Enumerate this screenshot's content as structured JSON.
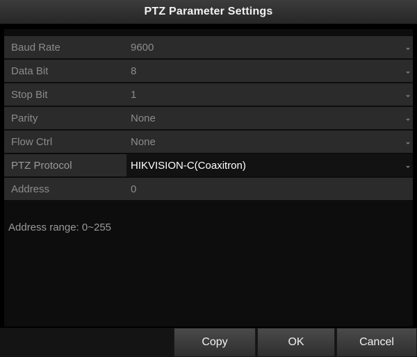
{
  "dialog": {
    "title": "PTZ Parameter Settings"
  },
  "fields": [
    {
      "label": "Baud Rate",
      "value": "9600",
      "dropdown": true
    },
    {
      "label": "Data Bit",
      "value": "8",
      "dropdown": true
    },
    {
      "label": "Stop Bit",
      "value": "1",
      "dropdown": true
    },
    {
      "label": "Parity",
      "value": "None",
      "dropdown": true
    },
    {
      "label": "Flow Ctrl",
      "value": "None",
      "dropdown": true
    },
    {
      "label": "PTZ Protocol",
      "value": "HIKVISION-C(Coaxitron)",
      "dropdown": true
    },
    {
      "label": "Address",
      "value": "0",
      "dropdown": false
    }
  ],
  "hint": "Address range: 0~255",
  "buttons": {
    "copy": "Copy",
    "ok": "OK",
    "cancel": "Cancel"
  },
  "icons": {
    "dropdown": "chevron-down-icon"
  },
  "colors": {
    "background": "#000000",
    "row": "#2b2b2b",
    "text_dim": "#8c8c8c",
    "text_active": "#ffffff"
  }
}
